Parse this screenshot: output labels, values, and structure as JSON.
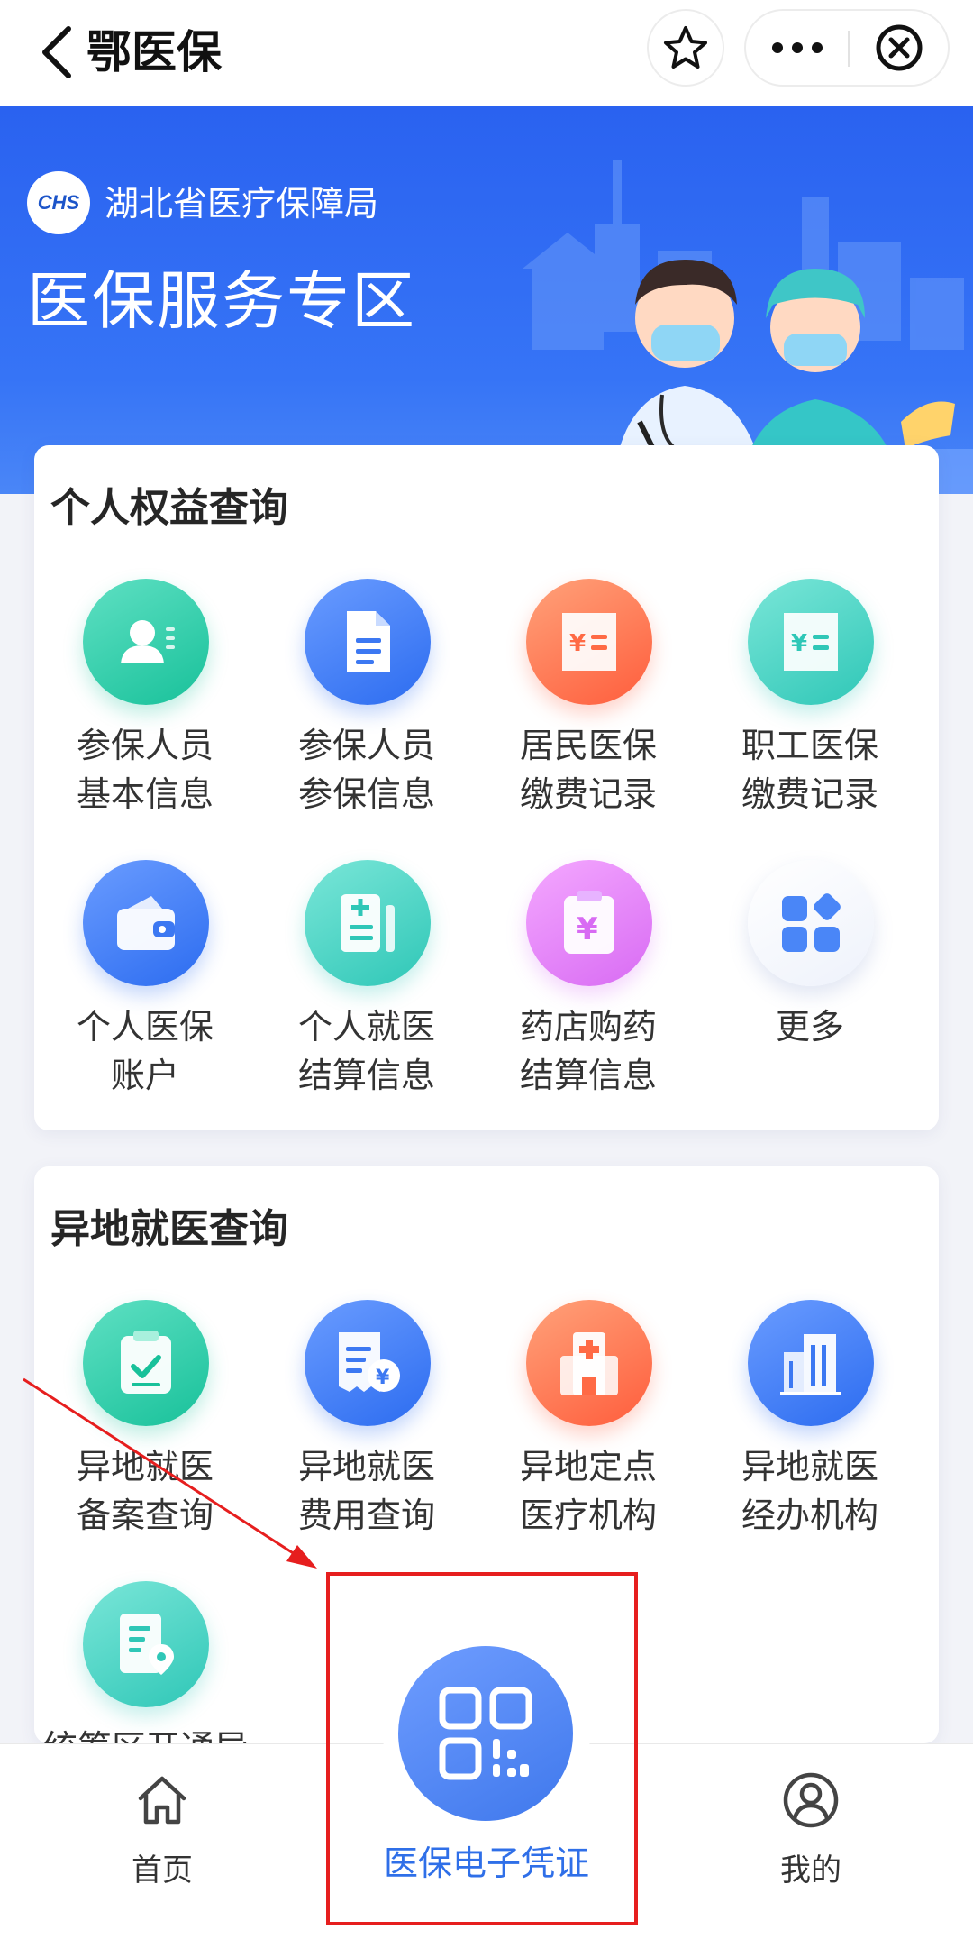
{
  "topbar": {
    "title": "鄂医保",
    "back_icon": "chevron-left-icon",
    "favorite_icon": "star-icon",
    "more_icon": "more-dots-icon",
    "close_icon": "close-circle-icon"
  },
  "banner": {
    "logo_text": "CHS",
    "org_name": "湖北省医疗保障局",
    "title": "医保服务专区"
  },
  "sections": [
    {
      "title": "个人权益查询",
      "items": [
        {
          "label": "参保人员\n基本信息",
          "icon": "person-card-icon",
          "color": "#18c19a"
        },
        {
          "label": "参保人员\n参保信息",
          "icon": "document-icon",
          "color": "#2c6cf0"
        },
        {
          "label": "居民医保\n缴费记录",
          "icon": "receipt-yen-icon",
          "color": "#ff5d3c"
        },
        {
          "label": "职工医保\n缴费记录",
          "icon": "receipt-yen-icon",
          "color": "#2fc7b7"
        },
        {
          "label": "个人医保\n账户",
          "icon": "wallet-icon",
          "color": "#2c6cf0"
        },
        {
          "label": "个人就医\n结算信息",
          "icon": "medical-record-icon",
          "color": "#2fc7b7"
        },
        {
          "label": "药店购药\n结算信息",
          "icon": "clipboard-yen-icon",
          "color": "#d86bf3"
        },
        {
          "label": "更多",
          "icon": "grid-more-icon",
          "color": "#4a86f7"
        }
      ]
    },
    {
      "title": "异地就医查询",
      "items": [
        {
          "label": "异地就医\n备案查询",
          "icon": "clipboard-check-icon",
          "color": "#18c19a"
        },
        {
          "label": "异地就医\n费用查询",
          "icon": "bill-yen-icon",
          "color": "#2c6cf0"
        },
        {
          "label": "异地定点\n医疗机构",
          "icon": "hospital-icon",
          "color": "#ff5d3c"
        },
        {
          "label": "异地就医\n经办机构",
          "icon": "building-icon",
          "color": "#2c6cf0"
        },
        {
          "label": "统筹区开通异",
          "icon": "document-location-icon",
          "color": "#2fc7b7"
        }
      ]
    }
  ],
  "tabbar": {
    "home": {
      "label": "首页",
      "icon": "home-icon"
    },
    "center": {
      "label": "医保电子凭证",
      "icon": "qr-code-icon"
    },
    "mine": {
      "label": "我的",
      "icon": "user-circle-icon"
    }
  },
  "annotation": {
    "color": "#e61e1e"
  }
}
